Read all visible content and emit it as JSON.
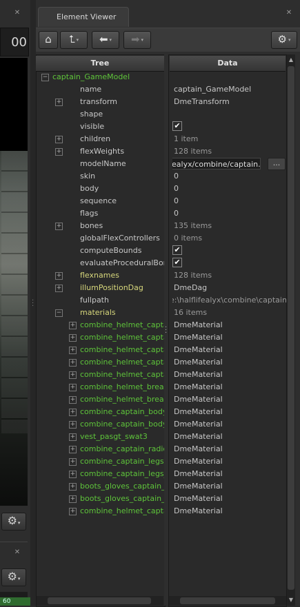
{
  "left_panel": {
    "close_icon": "close-icon",
    "value_text": "00",
    "gear_icon": "gear-icon",
    "bottom_value": "60"
  },
  "window": {
    "tab_title": "Element Viewer",
    "close_icon": "close-icon"
  },
  "toolbar": {
    "home_icon": "home-icon",
    "up_icon": "up-arrow-icon",
    "back_icon": "back-arrow-icon",
    "forward_icon": "forward-arrow-icon",
    "settings_icon": "gear-icon"
  },
  "columns": {
    "tree": "Tree",
    "data": "Data"
  },
  "rows": [
    {
      "name": "captain_GameModel",
      "value": "",
      "style": "green",
      "indent": 0,
      "expander": "minus",
      "kind": "text"
    },
    {
      "name": "name",
      "value": "captain_GameModel",
      "style": "normal",
      "indent": 1,
      "expander": "",
      "kind": "text"
    },
    {
      "name": "transform",
      "value": "DmeTransform",
      "style": "normal",
      "indent": 1,
      "expander": "plus",
      "kind": "text"
    },
    {
      "name": "shape",
      "value": "",
      "style": "normal",
      "indent": 1,
      "expander": "",
      "kind": "text"
    },
    {
      "name": "visible",
      "value": "✔",
      "style": "normal",
      "indent": 1,
      "expander": "",
      "kind": "check"
    },
    {
      "name": "children",
      "value": "1 item",
      "style": "normal",
      "indent": 1,
      "expander": "plus",
      "kind": "dim"
    },
    {
      "name": "flexWeights",
      "value": "128 items",
      "style": "normal",
      "indent": 1,
      "expander": "plus",
      "kind": "dim"
    },
    {
      "name": "modelName",
      "value": "ealyx/combine/captain.mdl",
      "style": "normal",
      "indent": 1,
      "expander": "",
      "kind": "field"
    },
    {
      "name": "skin",
      "value": "0",
      "style": "normal",
      "indent": 1,
      "expander": "",
      "kind": "text"
    },
    {
      "name": "body",
      "value": "0",
      "style": "normal",
      "indent": 1,
      "expander": "",
      "kind": "text"
    },
    {
      "name": "sequence",
      "value": "0",
      "style": "normal",
      "indent": 1,
      "expander": "",
      "kind": "text"
    },
    {
      "name": "flags",
      "value": "0",
      "style": "normal",
      "indent": 1,
      "expander": "",
      "kind": "text"
    },
    {
      "name": "bones",
      "value": "135 items",
      "style": "normal",
      "indent": 1,
      "expander": "plus",
      "kind": "dim"
    },
    {
      "name": "globalFlexControllers",
      "value": "0 items",
      "style": "normal",
      "indent": 1,
      "expander": "",
      "kind": "dim"
    },
    {
      "name": "computeBounds",
      "value": "✔",
      "style": "normal",
      "indent": 1,
      "expander": "",
      "kind": "check"
    },
    {
      "name": "evaluateProceduralBones",
      "value": "✔",
      "style": "normal",
      "indent": 1,
      "expander": "",
      "kind": "check"
    },
    {
      "name": "flexnames",
      "value": "128 items",
      "style": "yellow",
      "indent": 1,
      "expander": "plus",
      "kind": "dim"
    },
    {
      "name": "illumPositionDag",
      "value": "DmeDag",
      "style": "yellow",
      "indent": 1,
      "expander": "plus",
      "kind": "text"
    },
    {
      "name": "fullpath",
      "value": "e:\\halflifealyx\\combine\\captain.mdl",
      "style": "normal",
      "indent": 1,
      "expander": "",
      "kind": "path"
    },
    {
      "name": "materials",
      "value": "16 items",
      "style": "yellow",
      "indent": 1,
      "expander": "minus",
      "kind": "dim"
    },
    {
      "name": "combine_helmet_captain_",
      "value": "DmeMaterial",
      "style": "green",
      "indent": 2,
      "expander": "plus",
      "kind": "text"
    },
    {
      "name": "combine_helmet_captain_",
      "value": "DmeMaterial",
      "style": "green",
      "indent": 2,
      "expander": "plus",
      "kind": "text"
    },
    {
      "name": "combine_helmet_captain_",
      "value": "DmeMaterial",
      "style": "green",
      "indent": 2,
      "expander": "plus",
      "kind": "text"
    },
    {
      "name": "combine_helmet_captain_",
      "value": "DmeMaterial",
      "style": "green",
      "indent": 2,
      "expander": "plus",
      "kind": "text"
    },
    {
      "name": "combine_helmet_captain_",
      "value": "DmeMaterial",
      "style": "green",
      "indent": 2,
      "expander": "plus",
      "kind": "text"
    },
    {
      "name": "combine_helmet_breakab",
      "value": "DmeMaterial",
      "style": "green",
      "indent": 2,
      "expander": "plus",
      "kind": "text"
    },
    {
      "name": "combine_helmet_breakab",
      "value": "DmeMaterial",
      "style": "green",
      "indent": 2,
      "expander": "plus",
      "kind": "text"
    },
    {
      "name": "combine_captain_body",
      "value": "DmeMaterial",
      "style": "green",
      "indent": 2,
      "expander": "plus",
      "kind": "text"
    },
    {
      "name": "combine_captain_body_s",
      "value": "DmeMaterial",
      "style": "green",
      "indent": 2,
      "expander": "plus",
      "kind": "text"
    },
    {
      "name": "vest_pasgt_swat3",
      "value": "DmeMaterial",
      "style": "green",
      "indent": 2,
      "expander": "plus",
      "kind": "text"
    },
    {
      "name": "combine_captain_radio",
      "value": "DmeMaterial",
      "style": "green",
      "indent": 2,
      "expander": "plus",
      "kind": "text"
    },
    {
      "name": "combine_captain_legs",
      "value": "DmeMaterial",
      "style": "green",
      "indent": 2,
      "expander": "plus",
      "kind": "text"
    },
    {
      "name": "combine_captain_legs_s",
      "value": "DmeMaterial",
      "style": "green",
      "indent": 2,
      "expander": "plus",
      "kind": "text"
    },
    {
      "name": "boots_gloves_captain_d",
      "value": "DmeMaterial",
      "style": "green",
      "indent": 2,
      "expander": "plus",
      "kind": "text"
    },
    {
      "name": "boots_gloves_captain_s",
      "value": "DmeMaterial",
      "style": "green",
      "indent": 2,
      "expander": "plus",
      "kind": "text"
    },
    {
      "name": "combine_helmet_captain_",
      "value": "DmeMaterial",
      "style": "green",
      "indent": 2,
      "expander": "plus",
      "kind": "text"
    }
  ],
  "model_field_button": "...",
  "colors": {
    "green": "#5ec43a",
    "yellow": "#d7d77c",
    "background": "#2b2b2b"
  }
}
